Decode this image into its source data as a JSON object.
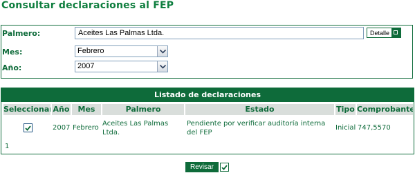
{
  "page": {
    "title": "Consultar declaraciones al FEP"
  },
  "filters": {
    "palmero_label": "Palmero:",
    "palmero_value": "Aceites Las Palmas Ltda.",
    "detalle_label": "Detalle",
    "mes_label": "Mes:",
    "mes_value": "Febrero",
    "anio_label": "Año:",
    "anio_value": "2007"
  },
  "list": {
    "title": "Listado de declaraciones",
    "columns": [
      "Seleccionar",
      "Año",
      "Mes",
      "Palmero",
      "Estado",
      "Tipo",
      "Comprobante"
    ],
    "rows": [
      {
        "selected": true,
        "anio": "2007",
        "mes": "Febrero",
        "palmero": "Aceites Las Palmas Ltda.",
        "estado": "Pendiente por verificar auditoría interna del FEP",
        "tipo": "Inicial",
        "comprobante": "747,5570"
      }
    ],
    "pager": "1"
  },
  "actions": {
    "revisar_label": "Revisar"
  },
  "colors": {
    "brand_green": "#0e6b3a",
    "title_green": "#0e7e3e",
    "header_gray": "#d9dedb"
  }
}
